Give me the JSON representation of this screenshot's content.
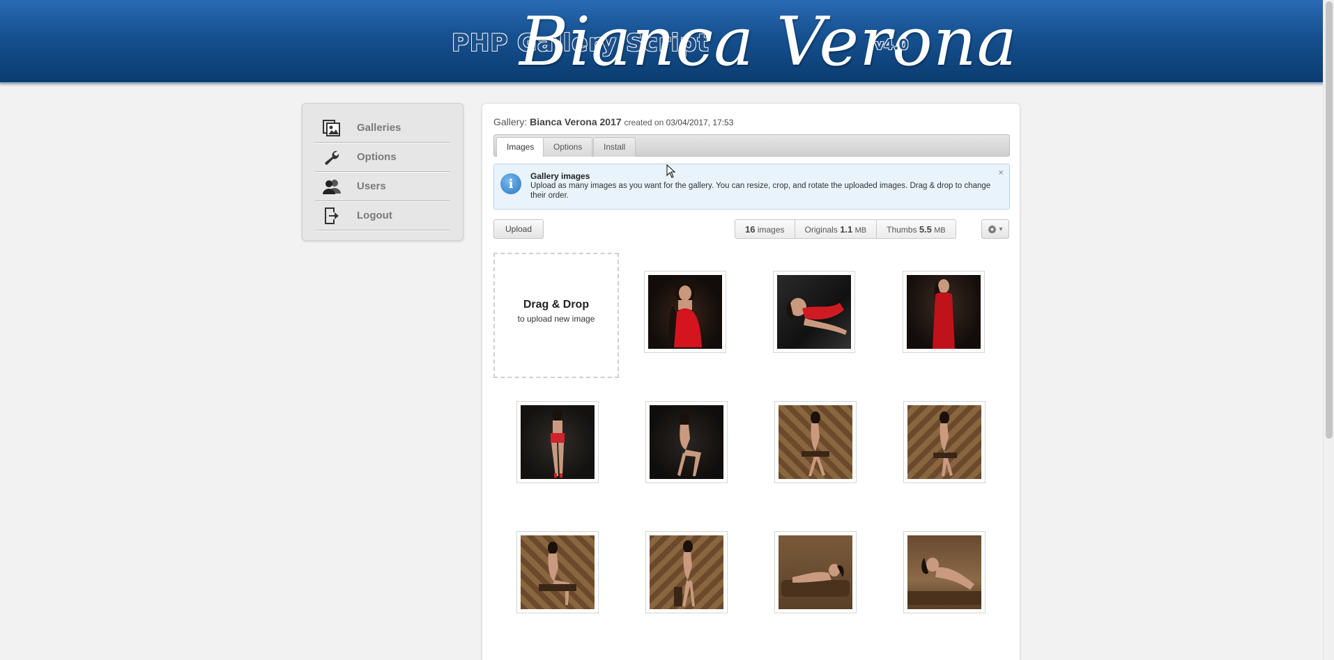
{
  "header": {
    "script_title": "PHP Gallery Script",
    "brand": "Bianca Verona",
    "version": "v4.0"
  },
  "sidebar": {
    "items": [
      {
        "label": "Galleries",
        "icon": "galleries-icon"
      },
      {
        "label": "Options",
        "icon": "wrench-icon"
      },
      {
        "label": "Users",
        "icon": "users-icon"
      },
      {
        "label": "Logout",
        "icon": "logout-icon"
      }
    ]
  },
  "gallery": {
    "prefix": "Gallery:",
    "name": "Bianca Verona 2017",
    "created_label": "created on",
    "created_at": "03/04/2017, 17:53"
  },
  "tabs": [
    {
      "label": "Images",
      "active": true
    },
    {
      "label": "Options",
      "active": false
    },
    {
      "label": "Install",
      "active": false
    }
  ],
  "info": {
    "title": "Gallery images",
    "text": "Upload as many images as you want for the gallery. You can resize, crop, and rotate the uploaded images. Drag & drop to change their order.",
    "close": "×"
  },
  "toolbar": {
    "upload_label": "Upload",
    "images_count": "16",
    "images_label": "images",
    "originals_label": "Originals",
    "originals_size": "1.1",
    "originals_unit": "MB",
    "thumbs_label": "Thumbs",
    "thumbs_size": "5.5",
    "thumbs_unit": "MB",
    "settings_icon": "gear-icon",
    "caret": "▾"
  },
  "dropzone": {
    "title": "Drag & Drop",
    "subtitle": "to upload new image"
  },
  "colors": {
    "header_top": "#2a6bb4",
    "header_bottom": "#0b3c70",
    "info_bg": "#e8f3fb"
  }
}
